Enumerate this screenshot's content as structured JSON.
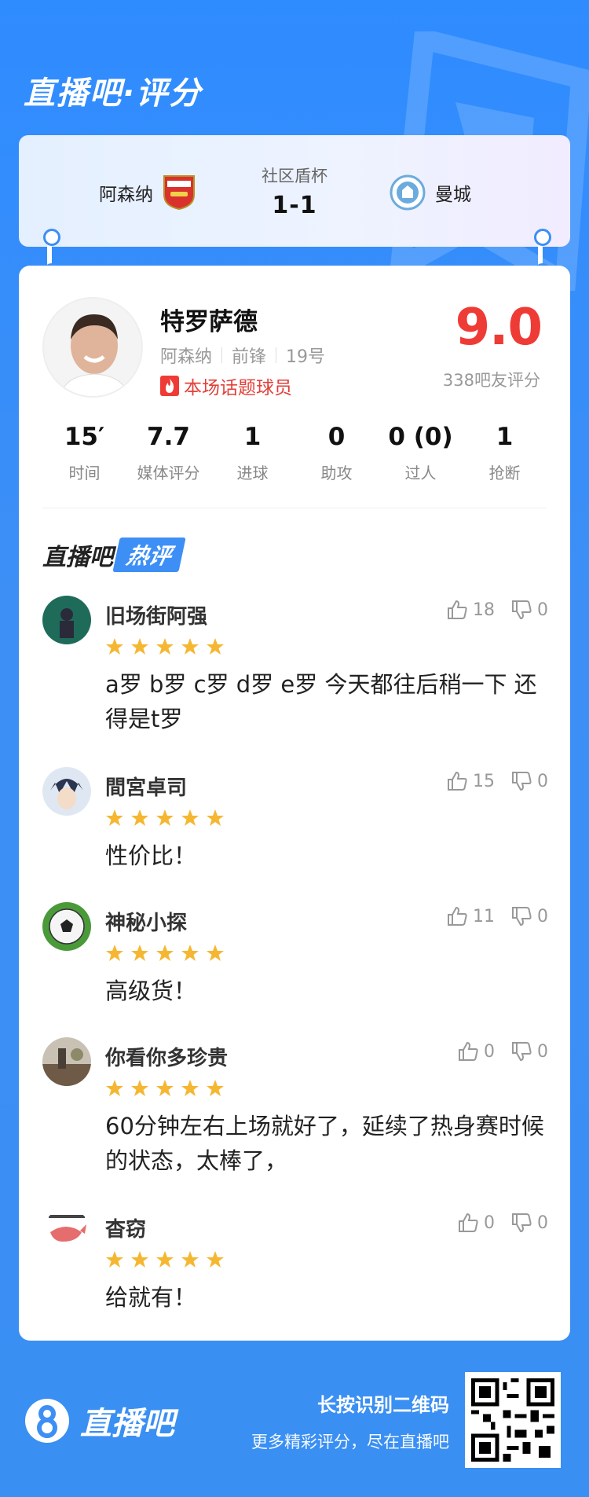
{
  "app_title": "直播吧·评分",
  "match": {
    "competition": "社区盾杯",
    "score": "1-1",
    "home_team": "阿森纳",
    "away_team": "曼城"
  },
  "player": {
    "name": "特罗萨德",
    "team": "阿森纳",
    "position": "前锋",
    "number": "19号",
    "hot_tag": "本场话题球员",
    "rating": "9.0",
    "rating_sub": "338吧友评分"
  },
  "stats": [
    {
      "value": "15′",
      "label": "时间"
    },
    {
      "value": "7.7",
      "label": "媒体评分"
    },
    {
      "value": "1",
      "label": "进球"
    },
    {
      "value": "0",
      "label": "助攻"
    },
    {
      "value": "0 (0)",
      "label": "过人"
    },
    {
      "value": "1",
      "label": "抢断"
    }
  ],
  "section": {
    "title_a": "直播吧",
    "title_b": "热评"
  },
  "comments": [
    {
      "name": "旧场街阿强",
      "text": "a罗 b罗 c罗 d罗 e罗 今天都往后稍一下 还得是t罗",
      "likes": "18",
      "dislikes": "0",
      "stars": 5
    },
    {
      "name": "間宮卓司",
      "text": "性价比！",
      "likes": "15",
      "dislikes": "0",
      "stars": 5
    },
    {
      "name": "神秘小探",
      "text": "高级货！",
      "likes": "11",
      "dislikes": "0",
      "stars": 5
    },
    {
      "name": "你看你多珍贵",
      "text": "60分钟左右上场就好了，延续了热身赛时候的状态，太棒了，",
      "likes": "0",
      "dislikes": "0",
      "stars": 5
    },
    {
      "name": "杳窃",
      "text": "给就有！",
      "likes": "0",
      "dislikes": "0",
      "stars": 5
    }
  ],
  "footer": {
    "brand": "直播吧",
    "cta_main": "长按识别二维码",
    "cta_sub": "更多精彩评分，尽在直播吧"
  },
  "colors": {
    "accent": "#3d8ff5",
    "rating": "#ef3b35",
    "star": "#f5b731"
  }
}
